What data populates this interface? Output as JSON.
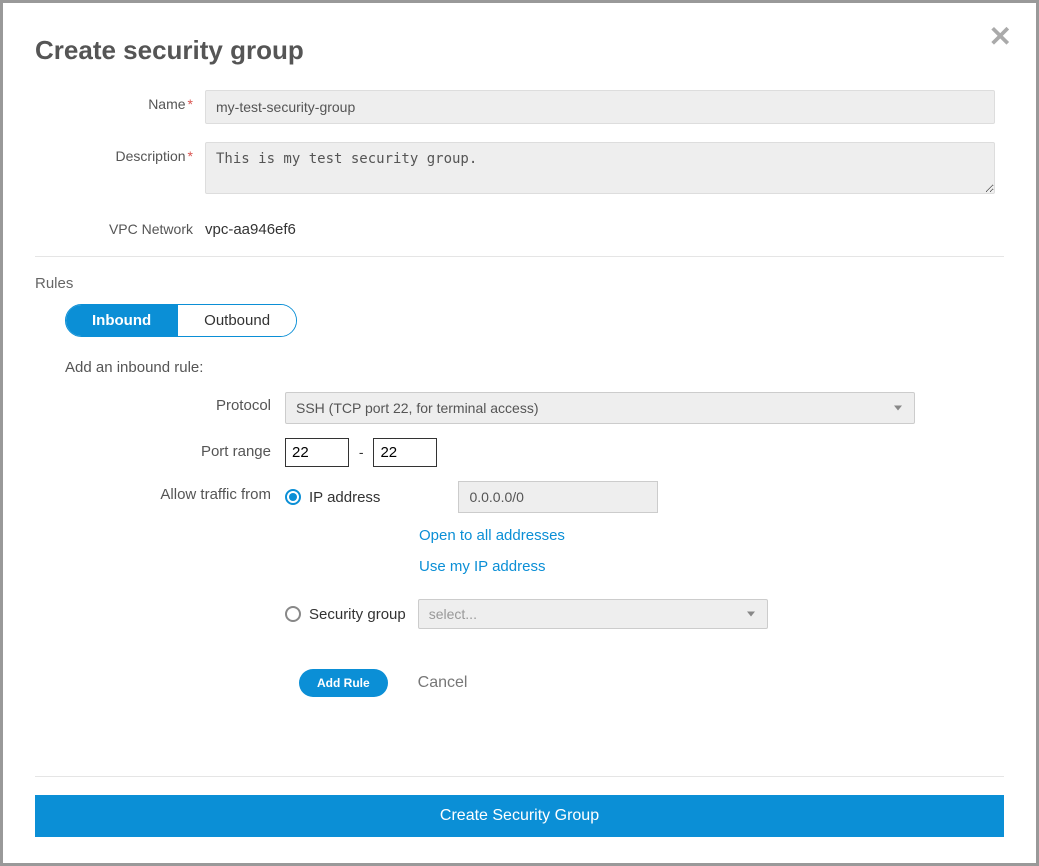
{
  "header": {
    "title": "Create security group"
  },
  "form": {
    "name_label": "Name",
    "name_value": "my-test-security-group",
    "description_label": "Description",
    "description_value": "This is my test security group.",
    "vpc_label": "VPC Network",
    "vpc_value": "vpc-aa946ef6"
  },
  "rules": {
    "section_label": "Rules",
    "tabs": {
      "inbound": "Inbound",
      "outbound": "Outbound"
    },
    "add_heading": "Add an inbound rule:",
    "protocol_label": "Protocol",
    "protocol_value": "SSH (TCP port 22, for terminal access)",
    "port_range_label": "Port range",
    "port_from": "22",
    "port_to": "22",
    "allow_label": "Allow traffic from",
    "ip_option_label": "IP address",
    "ip_value": "0.0.0.0/0",
    "open_all_link": "Open to all addresses",
    "use_my_ip_link": "Use my IP address",
    "sg_option_label": "Security group",
    "sg_select_placeholder": "select...",
    "add_rule_label": "Add Rule",
    "cancel_label": "Cancel"
  },
  "footer": {
    "create_label": "Create Security Group"
  }
}
